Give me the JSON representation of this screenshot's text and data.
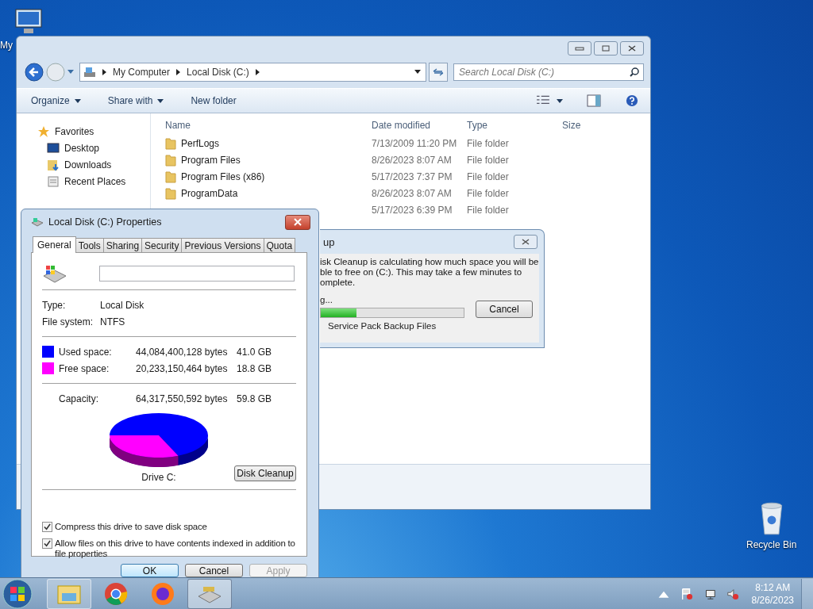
{
  "desktop": {
    "icons": [
      {
        "label": "My",
        "kind": "computer"
      },
      {
        "label": "Recycle Bin",
        "kind": "bin"
      }
    ]
  },
  "explorer": {
    "breadcrumb": [
      "My Computer",
      "Local Disk (C:)"
    ],
    "search": {
      "placeholder": "Search Local Disk (C:)"
    },
    "toolbar": [
      {
        "label": "Organize",
        "dropdown": true
      },
      {
        "label": "Share with",
        "dropdown": true
      },
      {
        "label": "New folder",
        "dropdown": false
      }
    ],
    "nav": [
      {
        "label": "Favorites",
        "kind": "star",
        "children": [
          {
            "label": "Desktop",
            "kind": "desktop"
          },
          {
            "label": "Downloads",
            "kind": "download"
          },
          {
            "label": "Recent Places",
            "kind": "recent"
          }
        ]
      }
    ],
    "columns": [
      "Name",
      "Date modified",
      "Type",
      "Size"
    ],
    "rows": [
      {
        "name": "PerfLogs",
        "date": "7/13/2009 11:20 PM",
        "type": "File folder"
      },
      {
        "name": "Program Files",
        "date": "8/26/2023 8:07 AM",
        "type": "File folder"
      },
      {
        "name": "Program Files (x86)",
        "date": "5/17/2023 7:37 PM",
        "type": "File folder"
      },
      {
        "name": "ProgramData",
        "date": "8/26/2023 8:07 AM",
        "type": "File folder"
      },
      {
        "date": "5/17/2023 6:39 PM",
        "type": "File folder"
      }
    ]
  },
  "cleanup": {
    "title": "up",
    "message": [
      "isk Cleanup is calculating how much space you will be",
      "ble to free on  (C:). This may take a few minutes to",
      "omplete."
    ],
    "status": "g...",
    "level": 0.25,
    "current": "Service Pack Backup Files",
    "button": "Cancel"
  },
  "properties": {
    "title": "Local Disk (C:) Properties",
    "tabs": [
      {
        "label": "General",
        "selected": true
      },
      {
        "label": "Tools",
        "selected": false
      },
      {
        "label": "Sharing",
        "selected": false
      },
      {
        "label": "Security",
        "selected": false
      },
      {
        "label": "Previous Versions",
        "selected": false
      },
      {
        "label": "Quota",
        "selected": false
      }
    ],
    "info": [
      {
        "label": "Type:",
        "value": "Local Disk"
      },
      {
        "label": "File system:",
        "value": "NTFS"
      }
    ],
    "spaces": [
      {
        "label": "Used space:",
        "bytes": "44,084,400,128 bytes",
        "size": "41.0 GB",
        "color": "#0000ff"
      },
      {
        "label": "Free space:",
        "bytes": "20,233,150,464 bytes",
        "size": "18.8 GB",
        "color": "#ff00ff"
      }
    ],
    "capacity": {
      "label": "Capacity:",
      "bytes": "64,317,550,592 bytes",
      "size": "59.8 GB"
    },
    "chart_label": "Drive C:",
    "cleanup_button": "Disk Cleanup",
    "options": [
      {
        "label": "Compress this drive to save disk space",
        "checked": true
      },
      {
        "label": "Allow files on this drive to have contents indexed in addition to file properties",
        "checked": true
      }
    ],
    "buttons": [
      {
        "label": "OK",
        "disabled": false,
        "default": true
      },
      {
        "label": "Cancel",
        "disabled": false,
        "default": false
      },
      {
        "label": "Apply",
        "disabled": true,
        "default": false
      }
    ]
  },
  "taskbar": {
    "apps": [
      {
        "kind": "explorer",
        "active": false
      },
      {
        "kind": "chrome",
        "active": false
      },
      {
        "kind": "firefox",
        "active": false
      },
      {
        "kind": "drive",
        "active": true
      }
    ],
    "time": "8:12 AM",
    "date": "8/26/2023"
  }
}
